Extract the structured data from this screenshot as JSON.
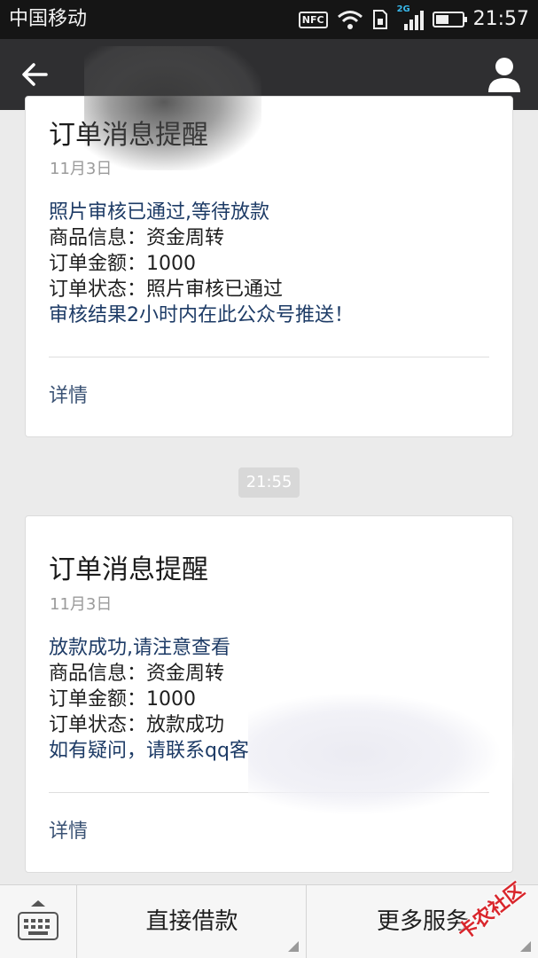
{
  "status_bar": {
    "carrier": "中国移动",
    "nfc": "NFC",
    "network_tag": "2G",
    "time": "21:57"
  },
  "cards": [
    {
      "title": "订单消息提醒",
      "date": "11月3日",
      "lines": [
        "照片审核已通过,等待放款",
        "商品信息：资金周转",
        "订单金额：1000",
        "订单状态：照片审核已通过",
        "审核结果2小时内在此公众号推送！"
      ],
      "details_label": "详情"
    },
    {
      "title": "订单消息提醒",
      "date": "11月3日",
      "lines": [
        "放款成功,请注意查看",
        "商品信息：资金周转",
        "订单金额：1000",
        "订单状态：放款成功",
        "如有疑问，请联系qq客"
      ],
      "details_label": "详情"
    }
  ],
  "time_separator": "21:55",
  "menu": {
    "direct_loan": "直接借款",
    "more_services": "更多服务"
  },
  "watermark": "卡农社区",
  "colors": {
    "accent_blue": "#1d3b66",
    "nav_bar": "#2f2f31",
    "watermark_red": "#d9262c"
  }
}
